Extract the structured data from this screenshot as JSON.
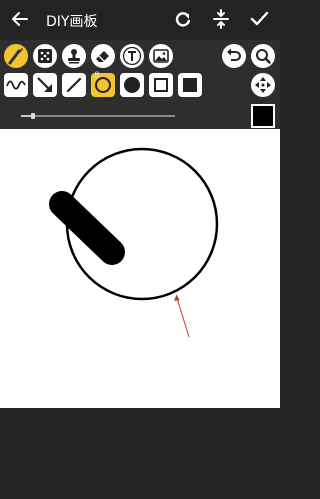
{
  "app": {
    "title": "DIY画板"
  },
  "brush": {
    "size": "8",
    "size_fraction": 0.08,
    "color": "#000000"
  },
  "colors": {
    "accent": "#f3c334",
    "toolbar_bg": "#2e2e2e",
    "appbar_bg": "#232323",
    "canvas_bg": "#ffffff",
    "annotation": "#c0392b"
  },
  "icons": {
    "header": [
      "back-arrow-icon",
      "refresh-icon",
      "compress-icon",
      "check-icon"
    ],
    "tools_row1": [
      "brush-icon",
      "dice-icon",
      "stamp-icon",
      "eraser-icon",
      "text-icon",
      "image-icon"
    ],
    "tools_row2": [
      "wave-line-icon",
      "arrow-icon",
      "line-icon",
      "circle-outline-icon",
      "circle-filled-icon",
      "square-outline-icon",
      "square-filled-icon"
    ],
    "side": [
      "undo-icon",
      "zoom-icon",
      "move-icon"
    ]
  }
}
